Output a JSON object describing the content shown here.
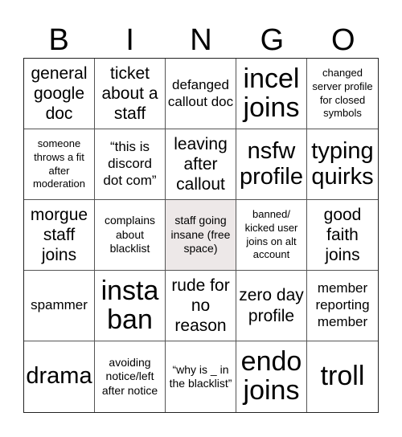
{
  "header": {
    "letters": [
      "B",
      "I",
      "N",
      "G",
      "O"
    ]
  },
  "free_space_color": "#ede8e8",
  "cells": [
    {
      "text": "general google doc",
      "size": "m"
    },
    {
      "text": "ticket about a staff",
      "size": "m"
    },
    {
      "text": "defanged callout doc",
      "size": "s"
    },
    {
      "text": "incel joins",
      "size": "xl"
    },
    {
      "text": "changed server profile for closed symbols",
      "size": "xxs"
    },
    {
      "text": "someone throws a fit after moderation",
      "size": "xxs"
    },
    {
      "text": "“this is discord dot com”",
      "size": "s"
    },
    {
      "text": "leaving after callout",
      "size": "m"
    },
    {
      "text": "nsfw profile",
      "size": "l"
    },
    {
      "text": "typing quirks",
      "size": "l"
    },
    {
      "text": "morgue staff joins",
      "size": "m"
    },
    {
      "text": "complains about blacklist",
      "size": "xs"
    },
    {
      "text": "staff going insane (free space)",
      "size": "xs",
      "free": true
    },
    {
      "text": "banned/ kicked user joins on alt account",
      "size": "xxs"
    },
    {
      "text": "good faith joins",
      "size": "m"
    },
    {
      "text": "spammer",
      "size": "s"
    },
    {
      "text": "insta ban",
      "size": "xl"
    },
    {
      "text": "rude for no reason",
      "size": "m"
    },
    {
      "text": "zero day profile",
      "size": "m"
    },
    {
      "text": "member reporting member",
      "size": "s"
    },
    {
      "text": "drama",
      "size": "l"
    },
    {
      "text": "avoiding notice/left after notice",
      "size": "xs"
    },
    {
      "text": "“why is _ in the blacklist”",
      "size": "xs"
    },
    {
      "text": "endo joins",
      "size": "xl"
    },
    {
      "text": "troll",
      "size": "xl"
    }
  ]
}
